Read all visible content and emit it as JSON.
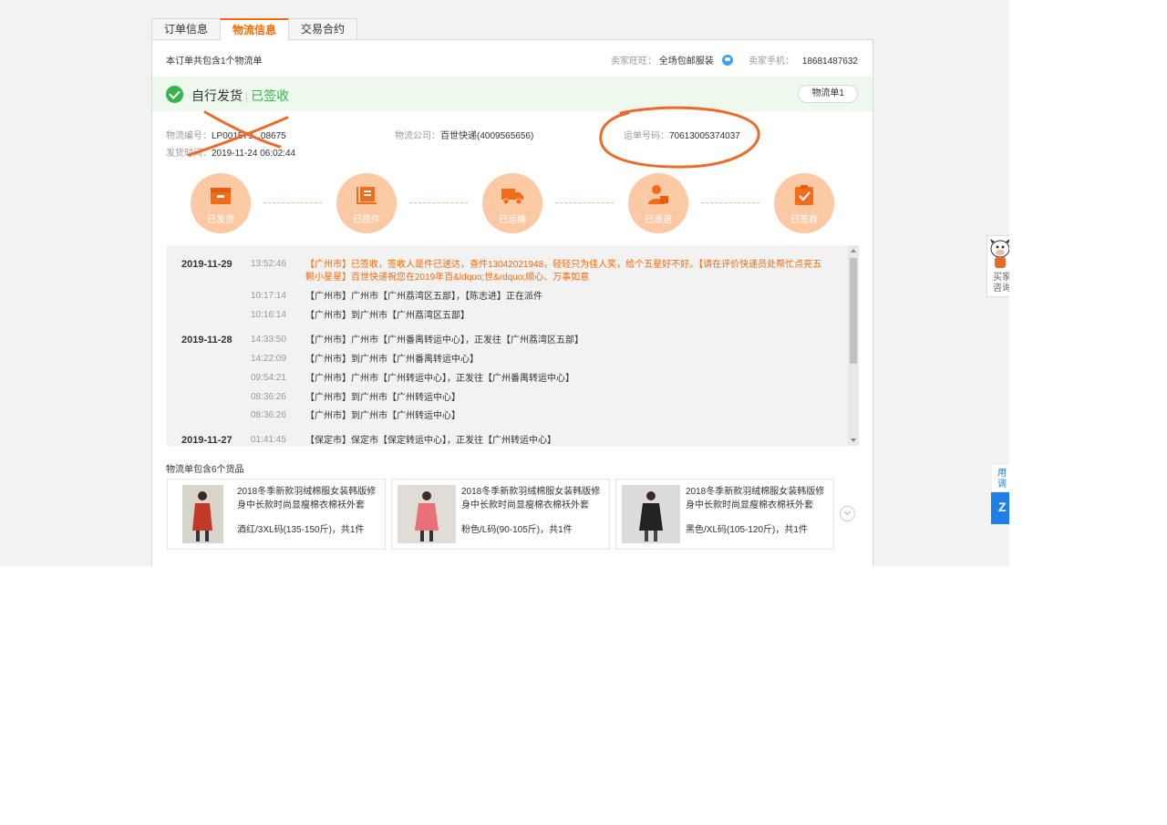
{
  "tabs": [
    {
      "label": "订单信息",
      "active": false
    },
    {
      "label": "物流信息",
      "active": true
    },
    {
      "label": "交易合约",
      "active": false
    }
  ],
  "summary": {
    "order_count_text": "本订单共包含1个物流单",
    "seller_wangwang_label": "卖家旺旺：",
    "seller_wangwang_value": "全场包邮服装",
    "seller_phone_label": "卖家手机：",
    "seller_phone_value": "18681487632"
  },
  "status": {
    "mode": "自行发货",
    "state": "已签收",
    "waybill_button": "物流单1",
    "accent_color": "#37b24d"
  },
  "info": {
    "logistics_no_label": "物流编号：",
    "logistics_no_value": "LP001579...08675",
    "ship_time_label": "发货时间：",
    "ship_time_value": "2019-11-24 06:02:44",
    "company_label": "物流公司：",
    "company_value": "百世快递(4009565656)",
    "tracking_label": "运单号码：",
    "tracking_value": "70613005374037"
  },
  "steps": [
    {
      "label": "已发货",
      "icon": "box-icon"
    },
    {
      "label": "已揽件",
      "icon": "package-pickup-icon"
    },
    {
      "label": "已运输",
      "icon": "truck-icon"
    },
    {
      "label": "已派送",
      "icon": "courier-icon"
    },
    {
      "label": "已签收",
      "icon": "clipboard-check-icon"
    }
  ],
  "tracking": [
    {
      "date": "2019-11-29",
      "time": "13:52:46",
      "desc": "【广州市】已签收，签收人是件已送达，查件13042021948，轻轻只为佳人笑，给个五星好不好。【请在评价快递员处帮忙点亮五颗小星星】百世快递祝您在2019年百&ldquo;世&rdquo;顺心、万事如意",
      "latest": true
    },
    {
      "date": "",
      "time": "10:17:14",
      "desc": "【广州市】广州市【广州荔湾区五部】，【陈志进】正在派件",
      "latest": false
    },
    {
      "date": "",
      "time": "10:16:14",
      "desc": "【广州市】到广州市【广州荔湾区五部】",
      "latest": false
    },
    {
      "date": "2019-11-28",
      "time": "14:33:50",
      "desc": "【广州市】广州市【广州番禺转运中心】，正发往【广州荔湾区五部】",
      "latest": false
    },
    {
      "date": "",
      "time": "14:22:09",
      "desc": "【广州市】到广州市【广州番禺转运中心】",
      "latest": false
    },
    {
      "date": "",
      "time": "09:54:21",
      "desc": "【广州市】广州市【广州转运中心】，正发往【广州番禺转运中心】",
      "latest": false
    },
    {
      "date": "",
      "time": "08:36:26",
      "desc": "【广州市】到广州市【广州转运中心】",
      "latest": false
    },
    {
      "date": "",
      "time": "08:36:26",
      "desc": "【广州市】到广州市【广州转运中心】",
      "latest": false
    },
    {
      "date": "2019-11-27",
      "time": "01:41:45",
      "desc": "【保定市】保定市【保定转运中心】，正发往【广州转运中心】",
      "latest": false
    }
  ],
  "goods": {
    "title": "物流单包含6个货品",
    "items": [
      {
        "name": "2018冬季新款羽绒棉服女装韩版修身中长款时尚显瘦棉衣棉袄外套",
        "spec": "酒红/3XL码(135-150斤)，共1件",
        "color": "#c0392b"
      },
      {
        "name": "2018冬季新款羽绒棉服女装韩版修身中长款时尚显瘦棉衣棉袄外套",
        "spec": "粉色/L码(90-105斤)，共1件",
        "color": "#e8707a"
      },
      {
        "name": "2018冬季新款羽绒棉服女装韩版修身中长款时尚显瘦棉衣棉袄外套",
        "spec": "黑色/XL码(105-120斤)，共1件",
        "color": "#222222"
      }
    ]
  },
  "side": {
    "cow_text_1": "买家",
    "cow_text_2": "咨询",
    "feedback_1": "用",
    "feedback_2": "调",
    "blue_char": "Z"
  },
  "colors": {
    "brand_orange": "#ff6600",
    "step_circle": "#fbc9a4",
    "annotation_orange": "#ec6a2a"
  }
}
